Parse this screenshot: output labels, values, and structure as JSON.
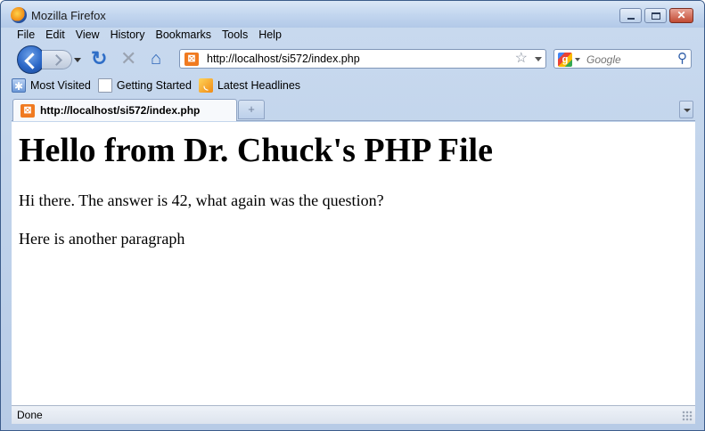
{
  "window": {
    "title": "Mozilla Firefox"
  },
  "menu": {
    "items": [
      "File",
      "Edit",
      "View",
      "History",
      "Bookmarks",
      "Tools",
      "Help"
    ]
  },
  "navbar": {
    "url": "http://localhost/si572/index.php",
    "search_placeholder": "Google"
  },
  "bookmarks": {
    "items": [
      {
        "label": "Most Visited",
        "icon": "most-visited-icon"
      },
      {
        "label": "Getting Started",
        "icon": "page-icon"
      },
      {
        "label": "Latest Headlines",
        "icon": "rss-icon"
      }
    ]
  },
  "tabs": [
    {
      "title": "http://localhost/si572/index.php",
      "active": true
    }
  ],
  "page": {
    "heading": "Hello from Dr. Chuck's PHP File",
    "paragraphs": [
      "Hi there. The answer is 42, what again was the question?",
      "Here is another paragraph"
    ]
  },
  "status": {
    "text": "Done"
  },
  "colors": {
    "accent": "#2a66c6",
    "site_icon": "#f07a20"
  }
}
